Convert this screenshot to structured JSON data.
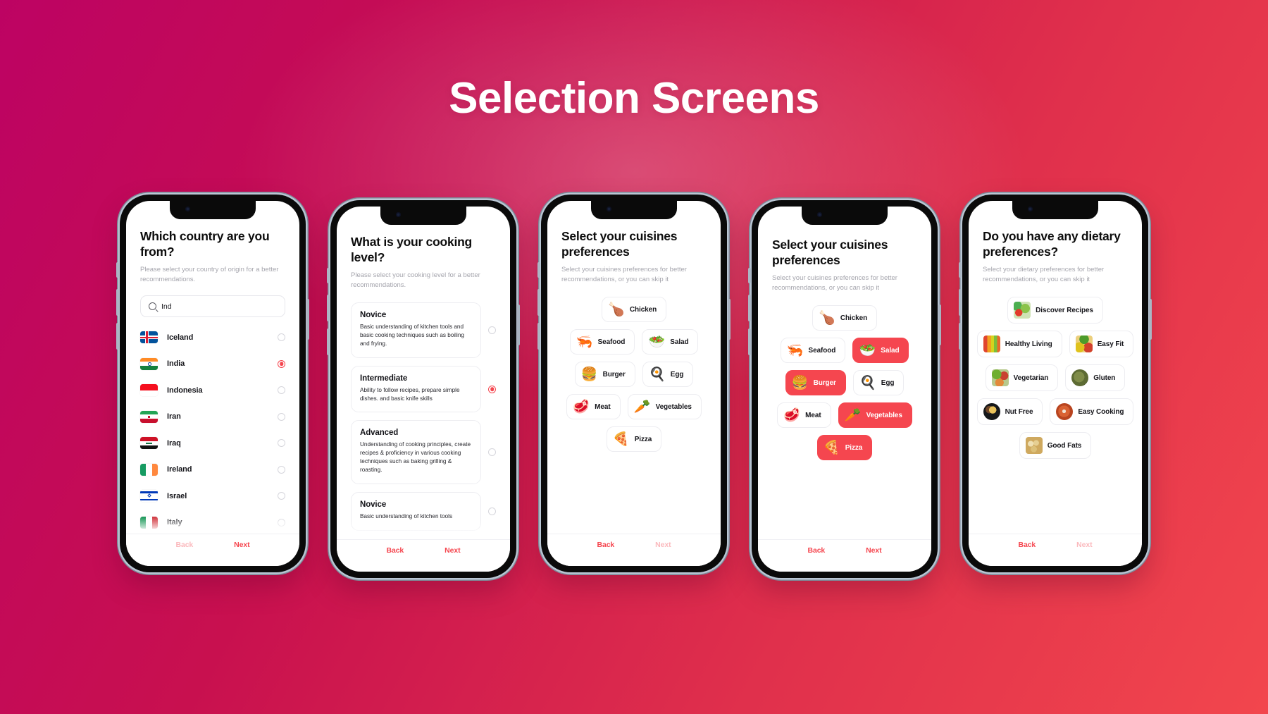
{
  "header": {
    "title": "Selection Screens"
  },
  "theme": {
    "accent": "#F5464F",
    "accent_dim": "#FBB9BD",
    "bg_start": "#BD0363",
    "bg_end": "#F2464D",
    "card_border": "#EDEDF1",
    "text": "#111116",
    "muted": "#A5A5AD"
  },
  "footer": {
    "back": "Back",
    "next": "Next"
  },
  "screens": [
    {
      "id": "country",
      "title": "Which country are you from?",
      "subtitle": "Please select your country of origin for a better recommendations.",
      "search": {
        "value": "Ind",
        "placeholder": "Search"
      },
      "countries": [
        {
          "name": "Iceland",
          "selected": false
        },
        {
          "name": "India",
          "selected": true
        },
        {
          "name": "Indonesia",
          "selected": false
        },
        {
          "name": "Iran",
          "selected": false
        },
        {
          "name": "Iraq",
          "selected": false
        },
        {
          "name": "Ireland",
          "selected": false
        },
        {
          "name": "Israel",
          "selected": false
        },
        {
          "name": "Italy",
          "selected": false
        }
      ],
      "footer": {
        "back": "Back",
        "back_disabled": true,
        "next": "Next",
        "next_disabled": false
      }
    },
    {
      "id": "cooking-level",
      "title": "What is your cooking level?",
      "subtitle": "Please select your cooking level for a better recommendations.",
      "levels": [
        {
          "name": "Novice",
          "description": "Basic understanding of kitchen tools and basic cooking techniques such as boiling and frying.",
          "selected": false
        },
        {
          "name": "Intermediate",
          "description": "Ability to follow recipes, prepare simple dishes. and basic knife skills",
          "selected": true
        },
        {
          "name": "Advanced",
          "description": "Understanding of cooking principles, create recipes & proficiency in various cooking techniques such as baking grilling & roasting.",
          "selected": false
        },
        {
          "name": "Novice",
          "description": "Basic understanding of kitchen tools",
          "selected": false
        }
      ],
      "footer": {
        "back": "Back",
        "back_disabled": false,
        "next": "Next",
        "next_disabled": false
      }
    },
    {
      "id": "cuisines-empty",
      "title": "Select your cuisines preferences",
      "subtitle": "Select your cuisines preferences for better recommendations, or you can skip it",
      "chip_rows": [
        [
          {
            "label": "Chicken",
            "icon": "chicken-leg-icon",
            "emoji": "🍗",
            "selected": false
          }
        ],
        [
          {
            "label": "Seafood",
            "icon": "shrimp-icon",
            "emoji": "🦐",
            "selected": false
          },
          {
            "label": "Salad",
            "icon": "salad-icon",
            "emoji": "🥗",
            "selected": false
          }
        ],
        [
          {
            "label": "Burger",
            "icon": "burger-icon",
            "emoji": "🍔",
            "selected": false
          },
          {
            "label": "Egg",
            "icon": "egg-icon",
            "emoji": "🍳",
            "selected": false
          }
        ],
        [
          {
            "label": "Meat",
            "icon": "meat-icon",
            "emoji": "🥩",
            "selected": false
          },
          {
            "label": "Vegetables",
            "icon": "vegetables-icon",
            "emoji": "🥕",
            "selected": false
          }
        ],
        [
          {
            "label": "Pizza",
            "icon": "pizza-icon",
            "emoji": "🍕",
            "selected": false
          }
        ]
      ],
      "footer": {
        "back": "Back",
        "back_disabled": false,
        "next": "Next",
        "next_disabled": true
      }
    },
    {
      "id": "cuisines-selected",
      "title": "Select your cuisines preferences",
      "subtitle": "Select your cuisines preferences for better recommendations, or you can skip it",
      "chip_rows": [
        [
          {
            "label": "Chicken",
            "icon": "chicken-leg-icon",
            "emoji": "🍗",
            "selected": false
          }
        ],
        [
          {
            "label": "Seafood",
            "icon": "shrimp-icon",
            "emoji": "🦐",
            "selected": false
          },
          {
            "label": "Salad",
            "icon": "salad-icon",
            "emoji": "🥗",
            "selected": true
          }
        ],
        [
          {
            "label": "Burger",
            "icon": "burger-icon",
            "emoji": "🍔",
            "selected": true
          },
          {
            "label": "Egg",
            "icon": "egg-icon",
            "emoji": "🍳",
            "selected": false
          }
        ],
        [
          {
            "label": "Meat",
            "icon": "meat-icon",
            "emoji": "🥩",
            "selected": false
          },
          {
            "label": "Vegetables",
            "icon": "vegetables-icon",
            "emoji": "🥕",
            "selected": true
          }
        ],
        [
          {
            "label": "Pizza",
            "icon": "pizza-icon",
            "emoji": "🍕",
            "selected": true
          }
        ]
      ],
      "footer": {
        "back": "Back",
        "back_disabled": false,
        "next": "Next",
        "next_disabled": false
      }
    },
    {
      "id": "dietary",
      "title": "Do you have any dietary preferences?",
      "subtitle": "Select your dietary preferences for better recommendations, or you can skip it",
      "chip_rows": [
        [
          {
            "label": "Discover Recipes",
            "icon": "vegetables-photo",
            "selected": false
          }
        ],
        [
          {
            "label": "Healthy Living",
            "icon": "juices-photo",
            "selected": false
          },
          {
            "label": "Easy Fit",
            "icon": "fruit-photo",
            "selected": false
          }
        ],
        [
          {
            "label": "Vegetarian",
            "icon": "veggie-basket-photo",
            "selected": false
          },
          {
            "label": "Gluten",
            "icon": "grain-bowl-photo",
            "selected": false
          }
        ],
        [
          {
            "label": "Nut Free",
            "icon": "plate-photo",
            "selected": false
          },
          {
            "label": "Easy Cooking",
            "icon": "soup-photo",
            "selected": false
          }
        ],
        [
          {
            "label": "Good Fats",
            "icon": "spread-photo",
            "selected": false
          }
        ]
      ],
      "footer": {
        "back": "Back",
        "back_disabled": false,
        "next": "Next",
        "next_disabled": true
      }
    }
  ]
}
